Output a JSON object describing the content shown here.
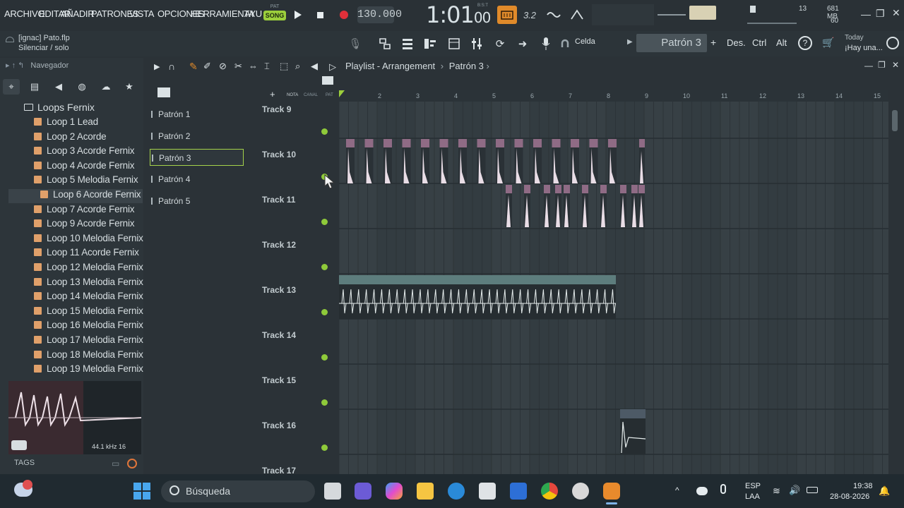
{
  "menu": {
    "items": [
      "ARCHIVO",
      "EDITAR",
      "AÑADIR",
      "PATRONES",
      "VISTA",
      "OPCIONES",
      "HERRAMIENTA",
      "AYU"
    ],
    "pat_label": "PAT",
    "song_label": "SONG",
    "tempo": "130.000",
    "time": "1:01",
    "time_sub": "00",
    "bst": "B:S:T",
    "stat_13": "13",
    "mem": "681 MB",
    "stat_60": "60"
  },
  "toolbar2": {
    "project": "[ignac] Pato.flp",
    "hint": "Silenciar / solo",
    "snap": "Celda",
    "pattern": "Patrón 3",
    "plus": "+",
    "des": "Des.",
    "ctrl": "Ctrl",
    "alt": "Alt",
    "news_day": "Today",
    "news_msg": "¡Hay una..."
  },
  "browser": {
    "nav_label": "Navegador",
    "folder": "Loops Fernix",
    "items": [
      "Loop 1 Lead",
      "Loop 2 Acorde",
      "Loop 3 Acorde Fernix",
      "Loop 4 Acorde Fernix",
      "Loop 5 Melodia Fernix",
      "Loop 6 Acorde Fernix",
      "Loop 7  Acorde Fernix",
      "Loop 9 Acorde Fernix",
      "Loop 10 Melodia Fernix",
      "Loop 11 Acorde Fernix",
      "Loop 12 Melodia Fernix",
      "Loop 13 Melodia Fernix",
      "Loop 14 Melodia Fernix",
      "Loop 15 Melodia Fernix",
      "Loop 16 Melodia Fernix",
      "Loop 17 Melodia Fernix",
      "Loop 18 Melodia Fernix",
      "Loop 19 Melodia Fernix"
    ],
    "selected_index": 5,
    "sample_info": "44.1 kHz 16",
    "tags": "TAGS"
  },
  "patterns": [
    "Patrón 1",
    "Patrón 2",
    "Patrón 3",
    "Patrón 4",
    "Patrón 5"
  ],
  "playlist": {
    "title": "Playlist - Arrangement",
    "crumb": "Patrón 3",
    "col_headers": [
      "NOTA",
      "CANAL",
      "PAT"
    ],
    "ruler": [
      "2",
      "3",
      "4",
      "5",
      "6",
      "7",
      "8",
      "9",
      "10",
      "11",
      "12",
      "13",
      "14",
      "15"
    ],
    "tracks": [
      "Track 9",
      "Track 10",
      "Track 11",
      "Track 12",
      "Track 13",
      "Track 14",
      "Track 15",
      "Track 16",
      "Track 17"
    ]
  },
  "taskbar": {
    "search": "Búsqueda",
    "lang1": "ESP",
    "lang2": "LAA",
    "clock": "19:38",
    "date": "28-08-2026"
  },
  "colors": {
    "accent_green": "#9ccf3c",
    "clip_pink": "#8f6b85",
    "clip_teal": "#5d7d7d",
    "record_red": "#e0303a"
  }
}
